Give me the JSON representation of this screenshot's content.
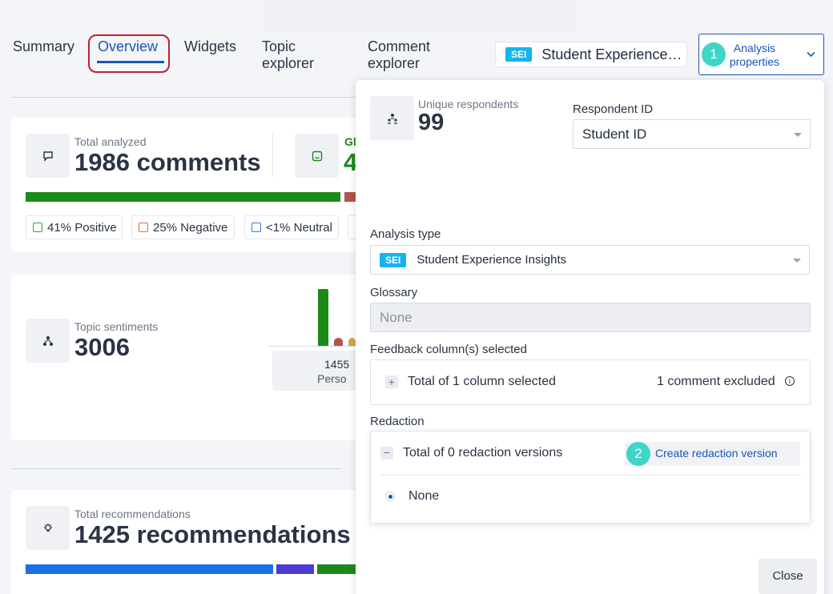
{
  "tabs": [
    {
      "label": "Summary"
    },
    {
      "label": "Overview",
      "active": true
    },
    {
      "label": "Widgets"
    },
    {
      "label": "Topic explorer"
    },
    {
      "label": "Comment explorer"
    }
  ],
  "analysis_selector": {
    "badge": "SEI",
    "label": "Student Experience…"
  },
  "analysis_properties_button": {
    "step": "1",
    "label": "Analysis properties",
    "icon": "chevron-down-icon"
  },
  "cards": {
    "total_analyzed": {
      "label": "Total analyzed",
      "value": "1986 comments",
      "partial_label": "Gl",
      "partial_value": "4"
    },
    "sentiment_pills": [
      {
        "label": "41% Positive",
        "color": "#2aa84a"
      },
      {
        "label": "25% Negative",
        "color": "#d9722e"
      },
      {
        "label": "<1% Neutral",
        "color": "#2f7bd9"
      }
    ],
    "topic_sentiments": {
      "label": "Topic sentiments",
      "value": "3006",
      "chart_value": "1455",
      "chart_caption": "Perso"
    },
    "recommendations": {
      "label": "Total recommendations",
      "value": "1425 recommendations"
    }
  },
  "panel": {
    "unique_respondents": {
      "label": "Unique respondents",
      "value": "99"
    },
    "respondent_id": {
      "label": "Respondent ID",
      "value": "Student ID"
    },
    "analysis_type": {
      "label": "Analysis type",
      "badge": "SEI",
      "value": "Student Experience Insights"
    },
    "glossary": {
      "label": "Glossary",
      "value": "None"
    },
    "feedback_columns": {
      "label": "Feedback column(s) selected",
      "summary": "Total of 1 column selected",
      "excluded": "1 comment excluded"
    },
    "redaction": {
      "label": "Redaction",
      "summary": "Total of 0 redaction versions",
      "step": "2",
      "create_label": "Create redaction version",
      "option": "None"
    },
    "close_label": "Close"
  },
  "colors": {
    "accent": "#1a55b5",
    "step": "#3fd5c7",
    "sei": "#15b4ef",
    "positive": "#1b8a1b",
    "negative": "#b5524a"
  }
}
